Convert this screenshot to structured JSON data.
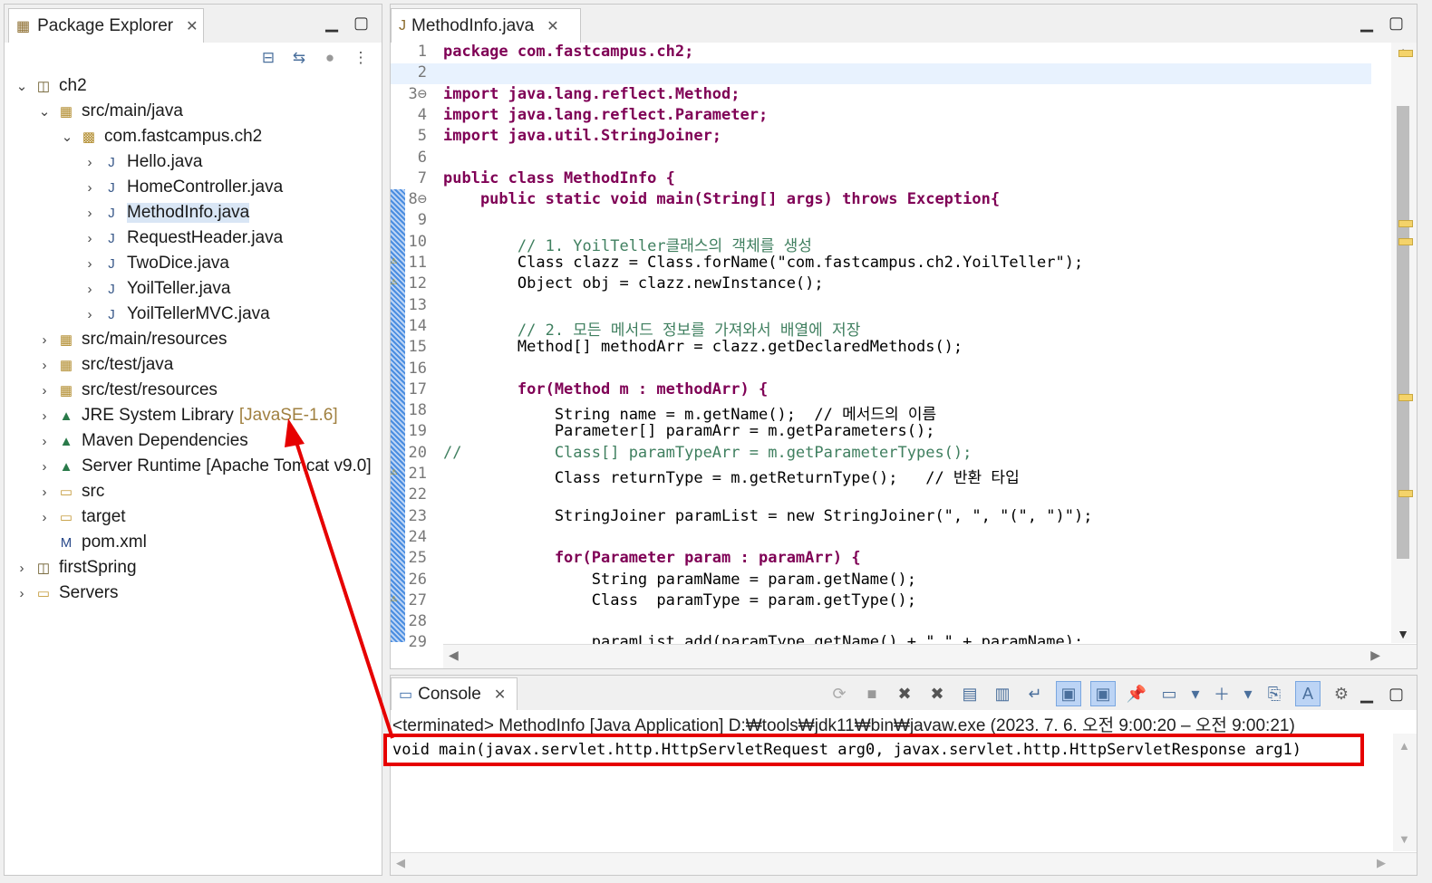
{
  "explorer": {
    "tab_label": "Package Explorer",
    "tree": [
      {
        "label": "ch2",
        "icon": "maven-project-icon",
        "expanded": true
      },
      {
        "label": "src/main/java",
        "icon": "source-folder-icon",
        "expanded": true
      },
      {
        "label": "com.fastcampus.ch2",
        "icon": "package-icon",
        "expanded": true
      },
      {
        "label": "Hello.java",
        "icon": "java-file-icon"
      },
      {
        "label": "HomeController.java",
        "icon": "java-file-icon"
      },
      {
        "label": "MethodInfo.java",
        "icon": "java-file-icon",
        "selected": true
      },
      {
        "label": "RequestHeader.java",
        "icon": "java-file-icon"
      },
      {
        "label": "TwoDice.java",
        "icon": "java-file-icon"
      },
      {
        "label": "YoilTeller.java",
        "icon": "java-file-icon"
      },
      {
        "label": "YoilTellerMVC.java",
        "icon": "java-file-icon"
      },
      {
        "label": "src/main/resources",
        "icon": "source-folder-icon"
      },
      {
        "label": "src/test/java",
        "icon": "source-folder-icon"
      },
      {
        "label": "src/test/resources",
        "icon": "source-folder-icon"
      },
      {
        "label": "JRE System Library",
        "decoration": "[JavaSE-1.6]",
        "icon": "library-icon"
      },
      {
        "label": "Maven Dependencies",
        "icon": "library-icon"
      },
      {
        "label": "Server Runtime [Apache Tomcat v9.0]",
        "icon": "library-icon"
      },
      {
        "label": "src",
        "icon": "folder-icon"
      },
      {
        "label": "target",
        "icon": "folder-icon"
      },
      {
        "label": "pom.xml",
        "icon": "maven-pom-icon"
      },
      {
        "label": "firstSpring",
        "icon": "maven-project-icon"
      },
      {
        "label": "Servers",
        "icon": "folder-icon"
      }
    ]
  },
  "editor": {
    "tab_label": "MethodInfo.java",
    "lines": [
      {
        "n": "1",
        "text": "package com.fastcampus.ch2;"
      },
      {
        "n": "2",
        "text": ""
      },
      {
        "n": "3⊖",
        "text": "import java.lang.reflect.Method;"
      },
      {
        "n": "4",
        "text": "import java.lang.reflect.Parameter;"
      },
      {
        "n": "5",
        "text": "import java.util.StringJoiner;"
      },
      {
        "n": "6",
        "text": ""
      },
      {
        "n": "7",
        "text": "public class MethodInfo {"
      },
      {
        "n": "8⊖",
        "text": "    public static void main(String[] args) throws Exception{"
      },
      {
        "n": "9",
        "text": ""
      },
      {
        "n": "10",
        "text": "        // 1. YoilTeller클래스의 객체를 생성"
      },
      {
        "n": "11",
        "text": "        Class clazz = Class.forName(\"com.fastcampus.ch2.YoilTeller\");"
      },
      {
        "n": "12",
        "text": "        Object obj = clazz.newInstance();"
      },
      {
        "n": "13",
        "text": ""
      },
      {
        "n": "14",
        "text": "        // 2. 모든 메서드 정보를 가져와서 배열에 저장"
      },
      {
        "n": "15",
        "text": "        Method[] methodArr = clazz.getDeclaredMethods();"
      },
      {
        "n": "16",
        "text": ""
      },
      {
        "n": "17",
        "text": "        for(Method m : methodArr) {"
      },
      {
        "n": "18",
        "text": "            String name = m.getName();  // 메서드의 이름"
      },
      {
        "n": "19",
        "text": "            Parameter[] paramArr = m.getParameters();"
      },
      {
        "n": "20",
        "text": "//          Class[] paramTypeArr = m.getParameterTypes();"
      },
      {
        "n": "21",
        "text": "            Class returnType = m.getReturnType();   // 반환 타입"
      },
      {
        "n": "22",
        "text": ""
      },
      {
        "n": "23",
        "text": "            StringJoiner paramList = new StringJoiner(\", \", \"(\", \")\");"
      },
      {
        "n": "24",
        "text": ""
      },
      {
        "n": "25",
        "text": "            for(Parameter param : paramArr) {"
      },
      {
        "n": "26",
        "text": "                String paramName = param.getName();"
      },
      {
        "n": "27",
        "text": "                Class  paramType = param.getType();"
      },
      {
        "n": "28",
        "text": ""
      },
      {
        "n": "29",
        "text": "                paramList.add(paramType.getName() + \" \" + paramName);"
      }
    ]
  },
  "console": {
    "tab_label": "Console",
    "status": "<terminated> MethodInfo [Java Application] D:₩tools₩jdk11₩bin₩javaw.exe  (2023. 7. 6. 오전 9:00:20 – 오전 9:00:21)",
    "output": "void main(javax.servlet.http.HttpServletRequest arg0, javax.servlet.http.HttpServletResponse arg1)"
  },
  "colors": {
    "annotation_red": "#e60000",
    "keyword": "#7f0055",
    "comment": "#3f7f5f",
    "string": "#2a00ff",
    "selection": "#d9e6f5"
  }
}
